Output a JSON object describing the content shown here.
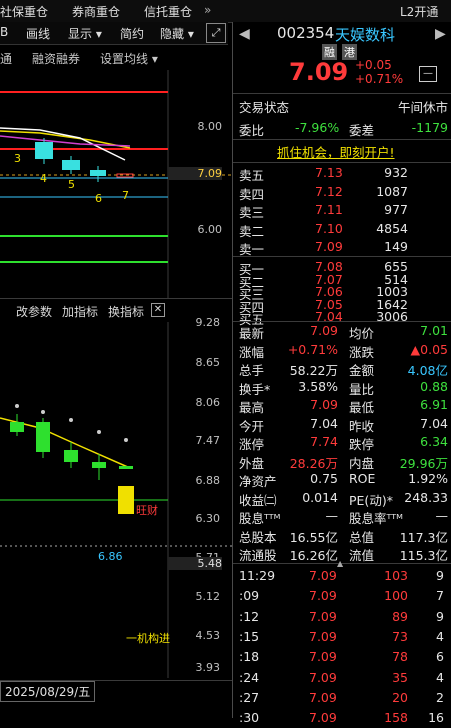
{
  "top_tabs": [
    "社保重仓",
    "券商重仓",
    "信托重仓",
    "»",
    "L2开通"
  ],
  "toolbar": {
    "items": [
      "画线",
      "显示 ▾",
      "简约",
      "隐藏 ▾"
    ],
    "fullscreen_icon": "expand-icon"
  },
  "toolbar2": {
    "items": [
      "通",
      "融资融券",
      "设置均线 ▾"
    ]
  },
  "main_chart": {
    "y_ticks": [
      "8.00",
      "7.09",
      "6.00"
    ],
    "markers": [
      "3",
      "4",
      "5",
      "6",
      "7"
    ]
  },
  "sub_chart": {
    "tabs": [
      "改参数",
      "加指标",
      "换指标"
    ],
    "close_label": "✕",
    "y_ticks": [
      "9.28",
      "8.65",
      "8.06",
      "7.47",
      "6.88",
      "6.30",
      "5.71",
      "5.48",
      "5.12",
      "4.53",
      "3.93"
    ],
    "current_value": "5.48",
    "annotations": {
      "wangcai": "旺财",
      "low": "6.86",
      "jigou": "一机构进"
    }
  },
  "date_bar": {
    "label": "2025/08/29/五"
  },
  "quote": {
    "code": "002354",
    "name": "天娱数科",
    "badges": [
      "融",
      "港"
    ],
    "price": "7.09",
    "change": "+0.05",
    "change_pct": "+0.71%",
    "minus_label": "—",
    "status_label": "交易状态",
    "status_value": "午间休市",
    "weibi_label": "委比",
    "weibi_value": "-7.96%",
    "weicha_label": "委差",
    "weicha_value": "-1179",
    "promo": "抓住机会，即刻开户!"
  },
  "order_book": {
    "asks": [
      {
        "label": "卖五",
        "price": "7.13",
        "vol": "932"
      },
      {
        "label": "卖四",
        "price": "7.12",
        "vol": "1087"
      },
      {
        "label": "卖三",
        "price": "7.11",
        "vol": "977"
      },
      {
        "label": "卖二",
        "price": "7.10",
        "vol": "4854"
      },
      {
        "label": "卖一",
        "price": "7.09",
        "vol": "149"
      }
    ],
    "bids": [
      {
        "label": "买一",
        "price": "7.08",
        "vol": "655"
      },
      {
        "label": "买二",
        "price": "7.07",
        "vol": "514"
      },
      {
        "label": "买三",
        "price": "7.06",
        "vol": "1003"
      },
      {
        "label": "买四",
        "price": "7.05",
        "vol": "1642"
      },
      {
        "label": "买五",
        "price": "7.04",
        "vol": "3006"
      }
    ]
  },
  "stats": [
    {
      "l1": "最新",
      "v1": "7.09",
      "c1": "red",
      "l2": "均价",
      "v2": "7.01",
      "c2": "grn"
    },
    {
      "l1": "涨幅",
      "v1": "+0.71%",
      "c1": "red",
      "l2": "涨跌",
      "v2": "▲0.05",
      "c2": "red"
    },
    {
      "l1": "总手",
      "v1": "58.22万",
      "c1": "wht",
      "l2": "金额",
      "v2": "4.08亿",
      "c2": "cyan"
    },
    {
      "l1": "换手*",
      "v1": "3.58%",
      "c1": "wht",
      "l2": "量比",
      "v2": "0.88",
      "c2": "grn"
    },
    {
      "l1": "最高",
      "v1": "7.09",
      "c1": "red",
      "l2": "最低",
      "v2": "6.91",
      "c2": "grn"
    },
    {
      "l1": "今开",
      "v1": "7.04",
      "c1": "wht",
      "l2": "昨收",
      "v2": "7.04",
      "c2": "wht"
    },
    {
      "l1": "涨停",
      "v1": "7.74",
      "c1": "red",
      "l2": "跌停",
      "v2": "6.34",
      "c2": "grn"
    },
    {
      "l1": "外盘",
      "v1": "28.26万",
      "c1": "red",
      "l2": "内盘",
      "v2": "29.96万",
      "c2": "grn"
    },
    {
      "l1": "净资产",
      "v1": "0.75",
      "c1": "wht",
      "l2": "ROE",
      "v2": "1.92%",
      "c2": "wht"
    },
    {
      "l1": "收益㈡",
      "v1": "0.014",
      "c1": "wht",
      "l2": "PE(动)*",
      "v2": "248.33",
      "c2": "wht"
    },
    {
      "l1": "股息ᵀᵀᴹ",
      "v1": "—",
      "c1": "wht",
      "l2": "股息率ᵀᵀᴹ",
      "v2": "—",
      "c2": "wht"
    },
    {
      "l1": "总股本",
      "v1": "16.55亿",
      "c1": "wht",
      "l2": "总值",
      "v2": "117.3亿",
      "c2": "wht"
    },
    {
      "l1": "流通股",
      "v1": "16.26亿",
      "c1": "wht",
      "l2": "流值",
      "v2": "115.3亿",
      "c2": "wht"
    }
  ],
  "ticks": [
    {
      "time": "11:29",
      "price": "7.09",
      "vol": "103",
      "n": "9"
    },
    {
      "time": ":09",
      "price": "7.09",
      "vol": "100",
      "n": "7"
    },
    {
      "time": ":12",
      "price": "7.09",
      "vol": "89",
      "n": "9"
    },
    {
      "time": ":15",
      "price": "7.09",
      "vol": "73",
      "n": "4"
    },
    {
      "time": ":18",
      "price": "7.09",
      "vol": "78",
      "n": "6"
    },
    {
      "time": ":24",
      "price": "7.09",
      "vol": "35",
      "n": "4"
    },
    {
      "time": ":27",
      "price": "7.09",
      "vol": "20",
      "n": "2"
    },
    {
      "time": ":30",
      "price": "7.09",
      "vol": "158",
      "n": "16"
    }
  ]
}
